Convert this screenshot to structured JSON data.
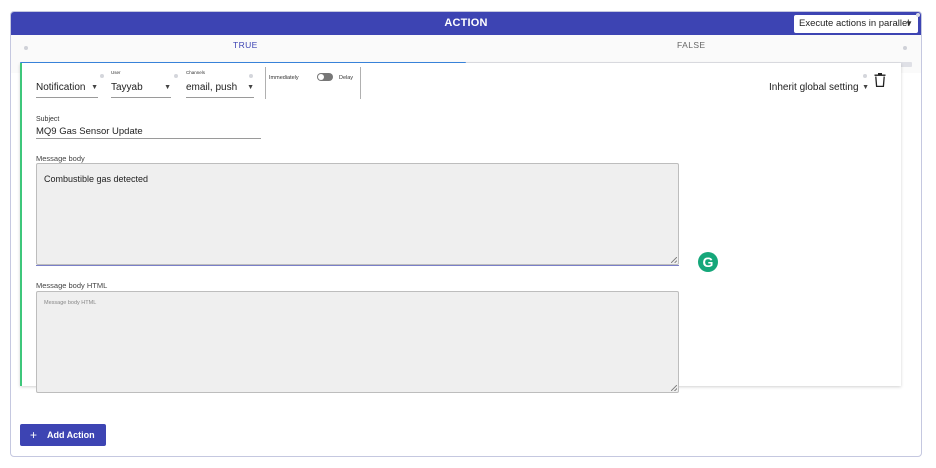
{
  "header": {
    "title": "ACTION",
    "execution_mode": "Execute actions in parallel"
  },
  "tabs": [
    {
      "label": "TRUE",
      "active": true
    },
    {
      "label": "FALSE",
      "active": false
    }
  ],
  "progress": {
    "fraction": 0.5
  },
  "action": {
    "type": "Notification",
    "user_label": "User",
    "user_value": "Tayyab",
    "channels_label": "Channels",
    "channels_value": "email, push",
    "timing": {
      "left_label": "Immediately",
      "right_label": "Delay",
      "on": false
    },
    "setting": "Inherit global setting",
    "subject_label": "Subject",
    "subject_value": "MQ9 Gas Sensor Update",
    "body_label": "Message body",
    "body_value": "Combustible gas detected",
    "html_label": "Message body HTML",
    "html_placeholder": "Message body HTML"
  },
  "grammarly_glyph": "G",
  "footer": {
    "add_label": "Add Action"
  },
  "colors": {
    "primary": "#3d44b3",
    "progress": "#3a86e0",
    "accent_border": "#3ec77b",
    "grammarly": "#15a77a"
  },
  "icons": {
    "delete": "trash-icon",
    "add": "plus-icon",
    "dropdown": "caret-down-icon"
  }
}
